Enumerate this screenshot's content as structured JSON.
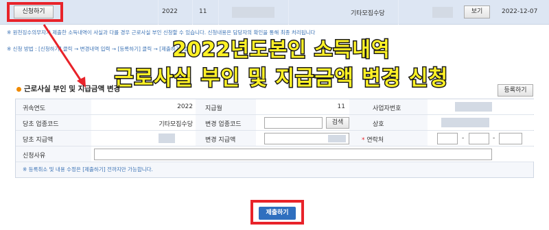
{
  "top_row": {
    "apply_label": "신청하기",
    "year": "2022",
    "month": "11",
    "industry": "기타모집수당",
    "view_label": "보기",
    "date": "2022-12-07"
  },
  "notes": {
    "line1": "※ 원천징수의무자가 제출한 소득내역이 사실과 다를 경우 근로사실 부인 신청할 수 있습니다. 신청내용은 담당자의 확인을 통해 최종 처리됩니다",
    "line2": "※ 신청 방법 : [신청하기] 클릭 → 변경내역 입력 → [등록하기] 클릭 → [제출하기] 클릭"
  },
  "overlay": {
    "line1": "2022년도본인 소득내역",
    "line2": "근로사실 부인 및 지급금액 변경 신청"
  },
  "section": {
    "title": "근로사실 부인 및 지급금액 변경",
    "register_label": "등록하기"
  },
  "form": {
    "row1": {
      "attr_year_label": "귀속연도",
      "attr_year_value": "2022",
      "pay_month_label": "지급월",
      "pay_month_value": "11",
      "biz_no_label": "사업자번호"
    },
    "row2": {
      "orig_code_label": "당초 업종코드",
      "orig_code_value": "기타모집수당",
      "new_code_label": "변경 업종코드",
      "search_label": "검색",
      "company_label": "상호"
    },
    "row3": {
      "orig_amount_label": "당초 지급액",
      "new_amount_label": "변경 지급액",
      "required_mark": "*",
      "contact_label": "연락처",
      "dash": "-"
    },
    "row4": {
      "reason_label": "신청사유"
    },
    "note": "※ 등록취소 및 내용 수정은 [제출하기] 전까지만 가능합니다."
  },
  "submit_label": "제출하기",
  "colors": {
    "highlight": "#e8232a",
    "overlay_text": "#fff226",
    "primary_button": "#2f6fbf",
    "note_text": "#3c73b5"
  }
}
